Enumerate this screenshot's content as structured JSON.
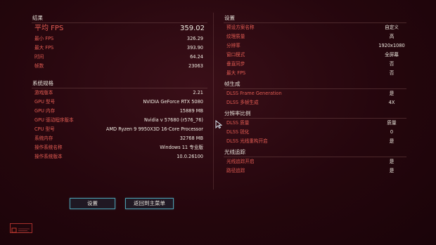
{
  "results": {
    "title": "结果",
    "avg_fps_label": "平均 FPS",
    "avg_fps": "359.02",
    "rows": [
      {
        "label": "最小 FPS",
        "value": "326.29"
      },
      {
        "label": "最大 FPS",
        "value": "393.90"
      },
      {
        "label": "时间",
        "value": "64.24"
      },
      {
        "label": "帧数",
        "value": "23063"
      }
    ]
  },
  "system": {
    "title": "系统规格",
    "rows": [
      {
        "label": "游戏版本",
        "value": "2.21"
      },
      {
        "label": "GPU 型号",
        "value": "NVIDIA GeForce RTX 5080"
      },
      {
        "label": "GPU 内存",
        "value": "15889 MB"
      },
      {
        "label": "GPU 驱动程序版本",
        "value": "Nvidia v 57680 (r576_76)"
      },
      {
        "label": "CPU 型号",
        "value": "AMD Ryzen 9 9950X3D 16-Core Processor"
      },
      {
        "label": "系统内存",
        "value": "32768 MB"
      },
      {
        "label": "操作系统名称",
        "value": "Windows 11 专业版"
      },
      {
        "label": "操作系统版本",
        "value": "10.0.26100"
      }
    ]
  },
  "settings": {
    "title": "设置",
    "rows": [
      {
        "label": "预设方案名称",
        "value": "自定义"
      },
      {
        "label": "纹理质量",
        "value": "高"
      },
      {
        "label": "分辨率",
        "value": "1920x1080"
      },
      {
        "label": "窗口模式",
        "value": "全屏幕"
      },
      {
        "label": "垂直同步",
        "value": "否"
      },
      {
        "label": "最大 FPS",
        "value": "否"
      }
    ]
  },
  "frame_gen": {
    "title": "帧生成",
    "rows": [
      {
        "label": "DLSS Frame Generation",
        "value": "是"
      },
      {
        "label": "DLSS 多帧生成",
        "value": "4X"
      }
    ]
  },
  "resolution_scale": {
    "title": "分辨率比例",
    "rows": [
      {
        "label": "DLSS 质量",
        "value": "质量"
      },
      {
        "label": "DLSS 锐化",
        "value": "0"
      },
      {
        "label": "DLSS 光线重构开启",
        "value": "是"
      }
    ]
  },
  "raytracing": {
    "title": "光线追踪",
    "rows": [
      {
        "label": "光线追踪开启",
        "value": "是"
      },
      {
        "label": "路径追踪",
        "value": "是"
      }
    ]
  },
  "buttons": {
    "settings": "设置",
    "main_menu": "返回到主菜单"
  },
  "icons": {
    "cursor": "cursor-arrow-icon",
    "logo": "brand-logo-icon"
  },
  "colors": {
    "label_red": "#e35c53",
    "value_white": "#f0ece2",
    "button_cyan": "#5ac8dc",
    "background": "#25060d"
  }
}
